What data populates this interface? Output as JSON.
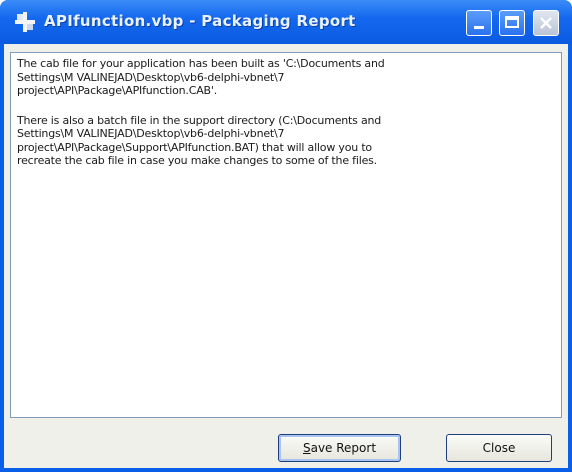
{
  "window": {
    "title": "APIfunction.vbp - Packaging Report"
  },
  "report": {
    "paragraphs": [
      "The cab file for your application has been built as 'C:\\Documents and\nSettings\\M VALINEJAD\\Desktop\\vb6-delphi-vbnet\\7\nproject\\API\\Package\\APIfunction.CAB'.",
      "There is also a batch file in the support directory (C:\\Documents and\nSettings\\M VALINEJAD\\Desktop\\vb6-delphi-vbnet\\7\nproject\\API\\Package\\Support\\APIfunction.BAT) that will allow you to\nrecreate the cab file in case you make changes to some of the files."
    ]
  },
  "buttons": {
    "save_mnemonic": "S",
    "save_rest": "ave Report",
    "close_label": "Close"
  },
  "icons": {
    "app": "setup-package-icon",
    "minimize": "minimize-icon",
    "maximize": "maximize-icon",
    "close": "close-icon"
  },
  "colors": {
    "titlebar": "#0a5ae0",
    "client_bg": "#f0f0ea",
    "text_area_bg": "#ffffff"
  }
}
